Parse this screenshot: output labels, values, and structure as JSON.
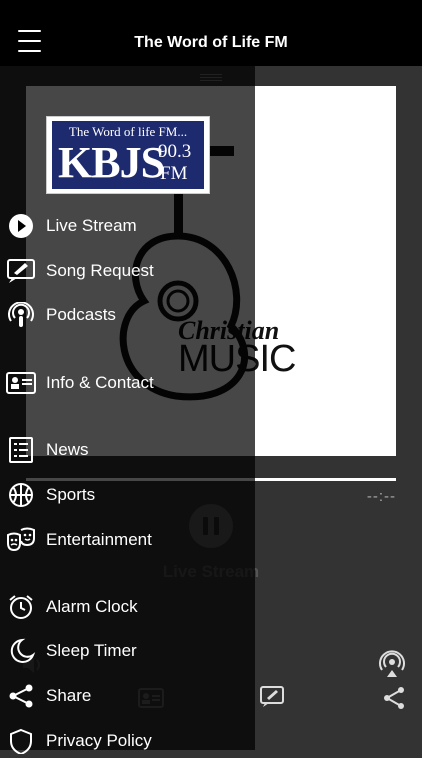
{
  "header": {
    "title": "The Word of Life FM"
  },
  "player": {
    "time_display": "--:--",
    "stream_title": "Live Stream",
    "progress_fraction": 1.0,
    "artwork": {
      "line1": "Christian",
      "line2": "MUSIC"
    }
  },
  "drawer": {
    "logo": {
      "tagline": "The Word of life FM...",
      "call_sign": "KBJS",
      "frequency": "90.3",
      "band": "FM"
    },
    "items": [
      {
        "label": "Live Stream",
        "icon": "play-circle-icon"
      },
      {
        "label": "Song Request",
        "icon": "edit-message-icon"
      },
      {
        "label": "Podcasts",
        "icon": "podcast-icon"
      },
      {
        "label": "Info & Contact",
        "icon": "contact-card-icon"
      },
      {
        "label": "News",
        "icon": "news-list-icon"
      },
      {
        "label": "Sports",
        "icon": "basketball-icon"
      },
      {
        "label": "Entertainment",
        "icon": "theater-masks-icon"
      },
      {
        "label": "Alarm Clock",
        "icon": "alarm-clock-icon"
      },
      {
        "label": "Sleep Timer",
        "icon": "moon-icon"
      },
      {
        "label": "Share",
        "icon": "share-icon"
      },
      {
        "label": "Privacy Policy",
        "icon": "shield-icon"
      }
    ]
  }
}
